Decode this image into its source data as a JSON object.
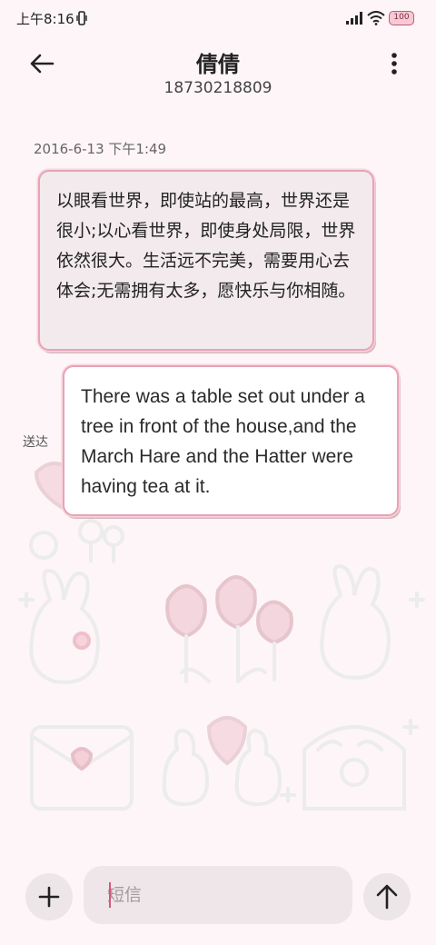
{
  "status_bar": {
    "time": "上午8:16",
    "battery": "100",
    "icons": [
      "vibrate-icon",
      "signal-icon",
      "wifi-icon",
      "battery-icon"
    ]
  },
  "header": {
    "back_icon": "arrow-left-icon",
    "contact_name": "倩倩",
    "contact_number": "18730218809",
    "menu_icon": "more-vertical-icon"
  },
  "conversation": {
    "timestamp": "2016-6-13 下午1:49",
    "messages": [
      {
        "direction": "incoming",
        "text": "以眼看世界，即使站的最高，世界还是很小;以心看世界，即使身处局限，世界依然很大。生活远不完美，需要用心去体会;无需拥有太多，愿快乐与你相随。"
      },
      {
        "direction": "outgoing",
        "text": "There was a table set out under a tree in front of the house,and the March Hare and the Hatter were having tea at it.",
        "status": "送达"
      }
    ]
  },
  "composer": {
    "add_icon": "plus-icon",
    "placeholder": "短信",
    "value": "",
    "send_icon": "arrow-up-icon"
  },
  "theme": {
    "background": "#fdf5f7",
    "bubble_border": "#e8a3b5",
    "accent": "#d8577a"
  }
}
